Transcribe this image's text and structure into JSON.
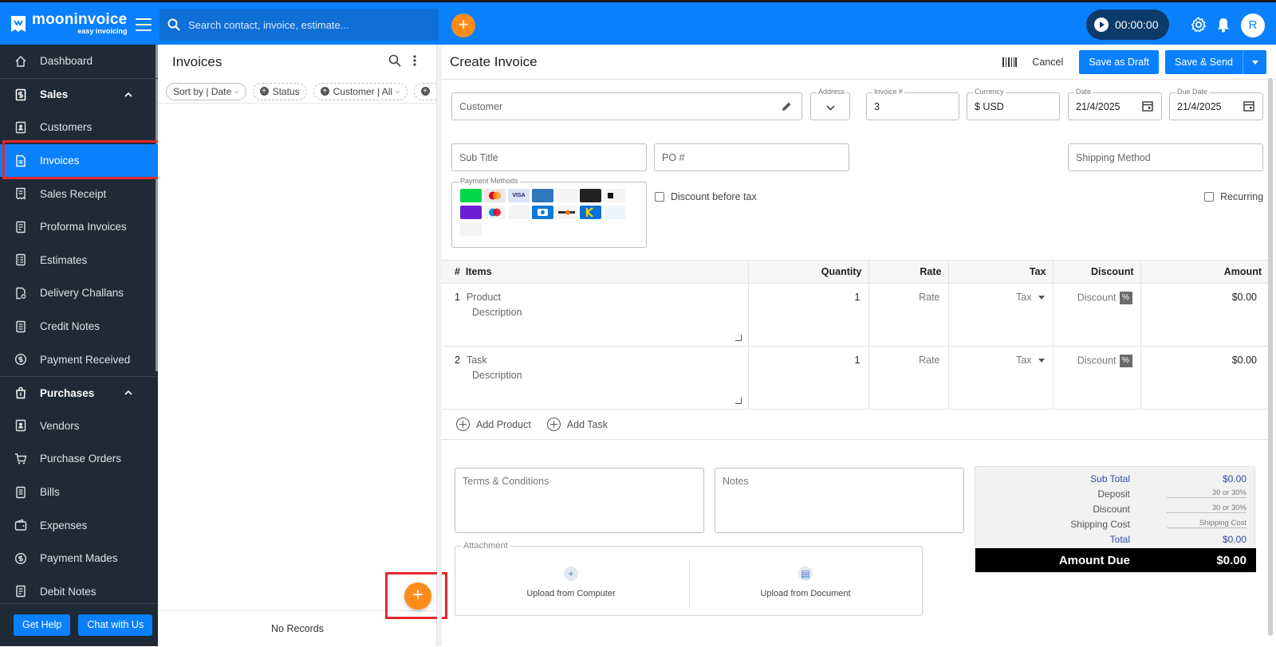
{
  "brand": {
    "name": "mooninvoice",
    "tagline": "easy invoicing",
    "accent": "#0a80fc",
    "orange": "#ff8c1a"
  },
  "topbar": {
    "search_placeholder": "Search contact, invoice, estimate...",
    "timer": "00:00:00",
    "avatar": "R"
  },
  "sidebar": {
    "items": [
      {
        "label": "Dashboard",
        "icon": "home-icon"
      },
      {
        "label": "Sales",
        "icon": "dollar-doc-icon",
        "section": true
      },
      {
        "label": "Customers",
        "icon": "contacts-icon"
      },
      {
        "label": "Invoices",
        "icon": "invoice-icon",
        "active": true
      },
      {
        "label": "Sales Receipt",
        "icon": "receipt-icon"
      },
      {
        "label": "Proforma Invoices",
        "icon": "doc-icon"
      },
      {
        "label": "Estimates",
        "icon": "list-icon"
      },
      {
        "label": "Delivery Challans",
        "icon": "delivery-icon"
      },
      {
        "label": "Credit Notes",
        "icon": "credit-icon"
      },
      {
        "label": "Payment Received",
        "icon": "coin-icon"
      },
      {
        "label": "Purchases",
        "icon": "bag-icon",
        "section": true
      },
      {
        "label": "Vendors",
        "icon": "contacts-icon"
      },
      {
        "label": "Purchase Orders",
        "icon": "cart-icon"
      },
      {
        "label": "Bills",
        "icon": "bill-icon"
      },
      {
        "label": "Expenses",
        "icon": "wallet-icon"
      },
      {
        "label": "Payment Mades",
        "icon": "coin-icon"
      },
      {
        "label": "Debit Notes",
        "icon": "debit-icon"
      }
    ],
    "get_help": "Get Help",
    "chat": "Chat with Us"
  },
  "list": {
    "title": "Invoices",
    "filters": {
      "sort": "Sort by | Date",
      "status": "Status",
      "customer": "Customer | All"
    },
    "empty": "No Records"
  },
  "form": {
    "title": "Create Invoice",
    "cancel": "Cancel",
    "save_draft": "Save as Draft",
    "save_send": "Save & Send",
    "customer_placeholder": "Customer",
    "address_label": "Address",
    "invoice_label": "Invoice #",
    "invoice_value": "3",
    "currency_label": "Currency",
    "currency_value": "$ USD",
    "date_label": "Date",
    "date_value": "21/4/2025",
    "due_label": "Due Date",
    "due_value": "21/4/2025",
    "subtitle_placeholder": "Sub Title",
    "po_placeholder": "PO #",
    "shipping_placeholder": "Shipping Method",
    "payment_methods_label": "Payment Methods",
    "discount_before_tax": "Discount before tax",
    "recurring": "Recurring"
  },
  "items": {
    "headers": {
      "num": "#",
      "items": "Items",
      "quantity": "Quantity",
      "rate": "Rate",
      "tax": "Tax",
      "discount": "Discount",
      "amount": "Amount"
    },
    "rows": [
      {
        "num": "1",
        "name": "Product",
        "desc": "Description",
        "qty": "1",
        "rate": "Rate",
        "tax": "Tax",
        "discount": "Discount",
        "pct": "%",
        "amount": "$0.00"
      },
      {
        "num": "2",
        "name": "Task",
        "desc": "Description",
        "qty": "1",
        "rate": "Rate",
        "tax": "Tax",
        "discount": "Discount",
        "pct": "%",
        "amount": "$0.00"
      }
    ],
    "add_product": "Add Product",
    "add_task": "Add Task"
  },
  "bottom": {
    "terms": "Terms & Conditions",
    "notes": "Notes",
    "attachment": "Attachment",
    "upload_computer": "Upload from Computer",
    "upload_document": "Upload from Document"
  },
  "totals": {
    "subtotal_label": "Sub Total",
    "subtotal": "$0.00",
    "deposit_label": "Deposit",
    "deposit": "30 or 30%",
    "discount_label": "Discount",
    "discount": "30 or 30%",
    "shipping_label": "Shipping Cost",
    "shipping": "Shipping Cost",
    "total_label": "Total",
    "total": "$0.00",
    "due_label": "Amount Due",
    "due": "$0.00"
  }
}
